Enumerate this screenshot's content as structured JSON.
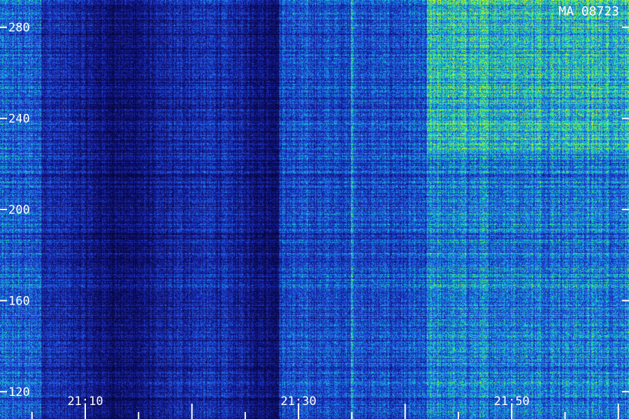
{
  "chart_data": {
    "type": "heatmap",
    "title": "MA 08723",
    "xlabel": "",
    "ylabel": "",
    "x_ticks": [
      "21:10",
      "21:30",
      "21:50"
    ],
    "x_tick_minutes": [
      10,
      30,
      50
    ],
    "x_range_minutes": [
      2,
      61
    ],
    "y_ticks": [
      280,
      240,
      200,
      160,
      120
    ],
    "ylim": [
      108,
      292
    ],
    "colormap": [
      "#000000",
      "#0a0a5a",
      "#1e32c8",
      "#1e6ee6",
      "#14b4dc",
      "#1ee6aa",
      "#64f046",
      "#c8f020"
    ],
    "features": [
      {
        "name": "bright band",
        "from_minute": 42,
        "to_minute": 61,
        "level": "high",
        "upper_freq_from": 225
      },
      {
        "name": "narrow vertical line",
        "at_minute": 35,
        "level": "high"
      }
    ]
  },
  "icons": {
    "corner_text_color": "#ffffff",
    "axis_color": "#ffffff"
  }
}
